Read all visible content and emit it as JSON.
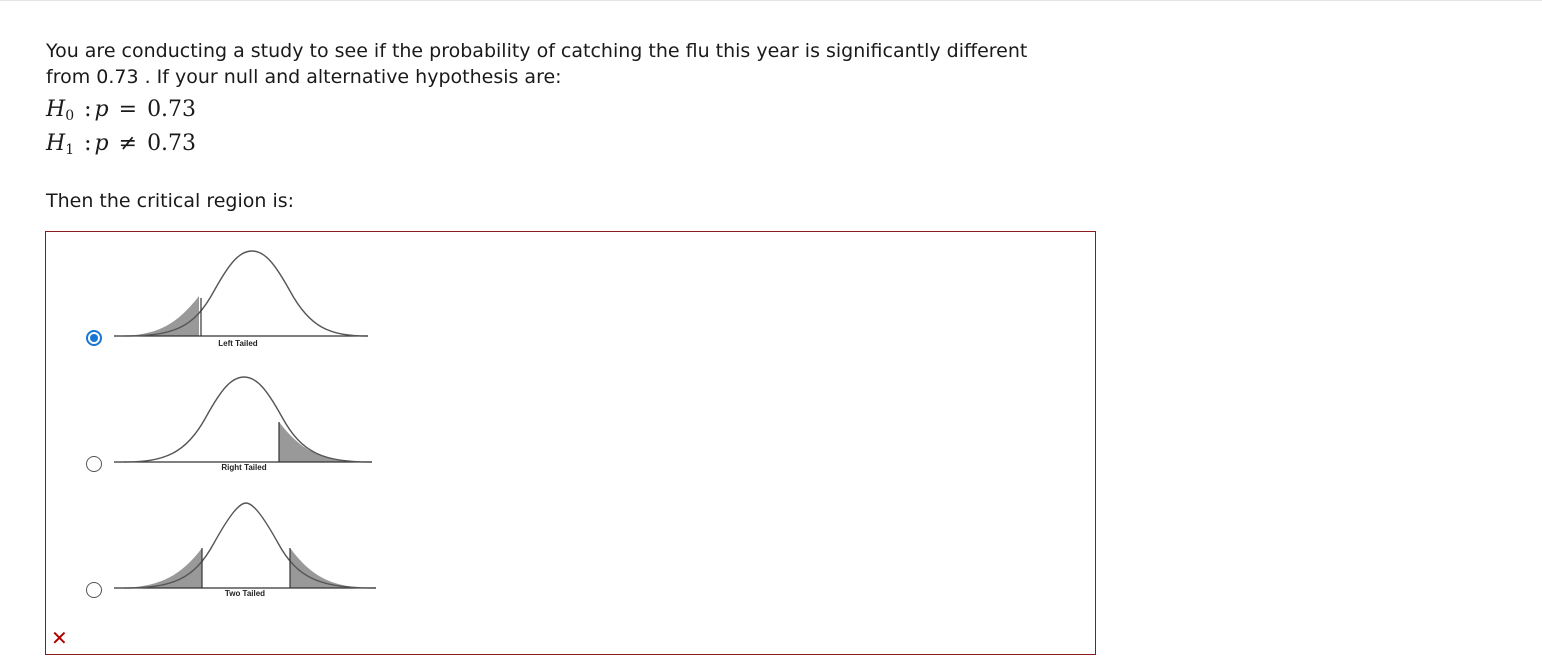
{
  "question": {
    "line1": "You are conducting a study to see if the probability of catching the flu this year is significantly different",
    "line2": "from 0.73 . If your null and alternative hypothesis are:"
  },
  "hypotheses": {
    "h0": {
      "symbol": "H",
      "subscript": "0",
      "variable": "p",
      "operator": "=",
      "value": "0.73"
    },
    "h1": {
      "symbol": "H",
      "subscript": "1",
      "variable": "p",
      "operator": "≠",
      "value": "0.73"
    }
  },
  "prompt": "Then the critical region is:",
  "options": [
    {
      "label": "Left Tailed",
      "selected": true
    },
    {
      "label": "Right Tailed",
      "selected": false
    },
    {
      "label": "Two Tailed",
      "selected": false
    }
  ],
  "feedback": {
    "result": "incorrect",
    "icon": "x-mark-icon",
    "symbol": "✕",
    "color": "#b00000"
  },
  "colors": {
    "selected_radio": "#1976d2",
    "box_border": "#8b1a1a",
    "tail_fill": "#999999"
  }
}
